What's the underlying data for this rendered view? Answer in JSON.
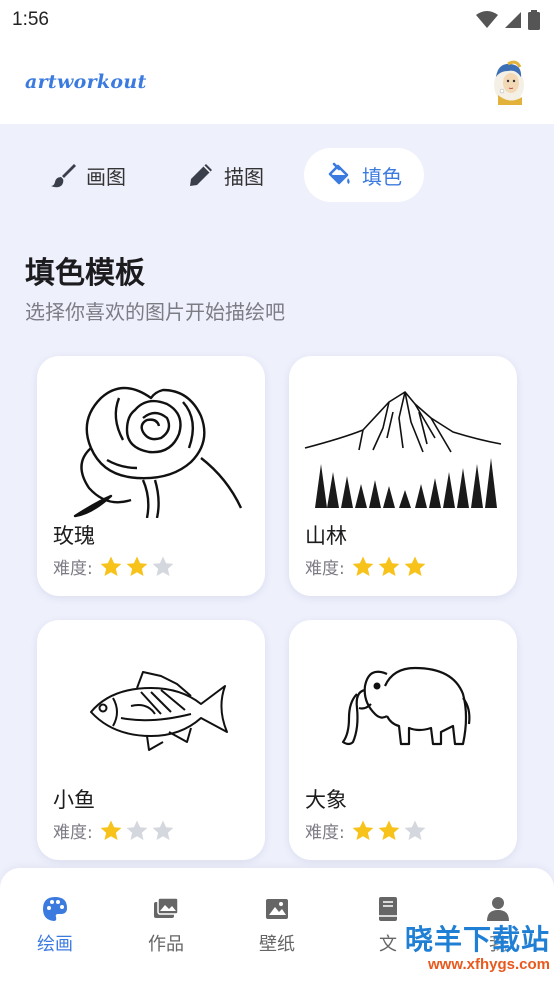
{
  "status_bar": {
    "time": "1:56"
  },
  "app": {
    "logo": "artworkout"
  },
  "modes": [
    {
      "label": "画图",
      "icon": "brush-icon",
      "active": false
    },
    {
      "label": "描图",
      "icon": "pencil-icon",
      "active": false
    },
    {
      "label": "填色",
      "icon": "paint-bucket-icon",
      "active": true
    }
  ],
  "section": {
    "title": "填色模板",
    "subtitle": "选择你喜欢的图片开始描绘吧"
  },
  "difficulty_label": "难度:",
  "templates": [
    {
      "name": "玫瑰",
      "difficulty": 2,
      "max": 3
    },
    {
      "name": "山林",
      "difficulty": 3,
      "max": 3
    },
    {
      "name": "小鱼",
      "difficulty": 1,
      "max": 3
    },
    {
      "name": "大象",
      "difficulty": 2,
      "max": 3
    }
  ],
  "bottom_nav": [
    {
      "label": "绘画",
      "icon": "palette-icon",
      "active": true
    },
    {
      "label": "作品",
      "icon": "gallery-icon",
      "active": false
    },
    {
      "label": "壁纸",
      "icon": "image-icon",
      "active": false
    },
    {
      "label": "文",
      "icon": "book-icon",
      "active": false
    },
    {
      "label": "我",
      "icon": "person-icon",
      "active": false
    }
  ],
  "watermark": {
    "text": "晓羊下载站",
    "url": "www.xfhygs.com"
  },
  "colors": {
    "accent": "#3b7be0",
    "star_on": "#f7c21a",
    "star_off": "#d5d7de"
  }
}
